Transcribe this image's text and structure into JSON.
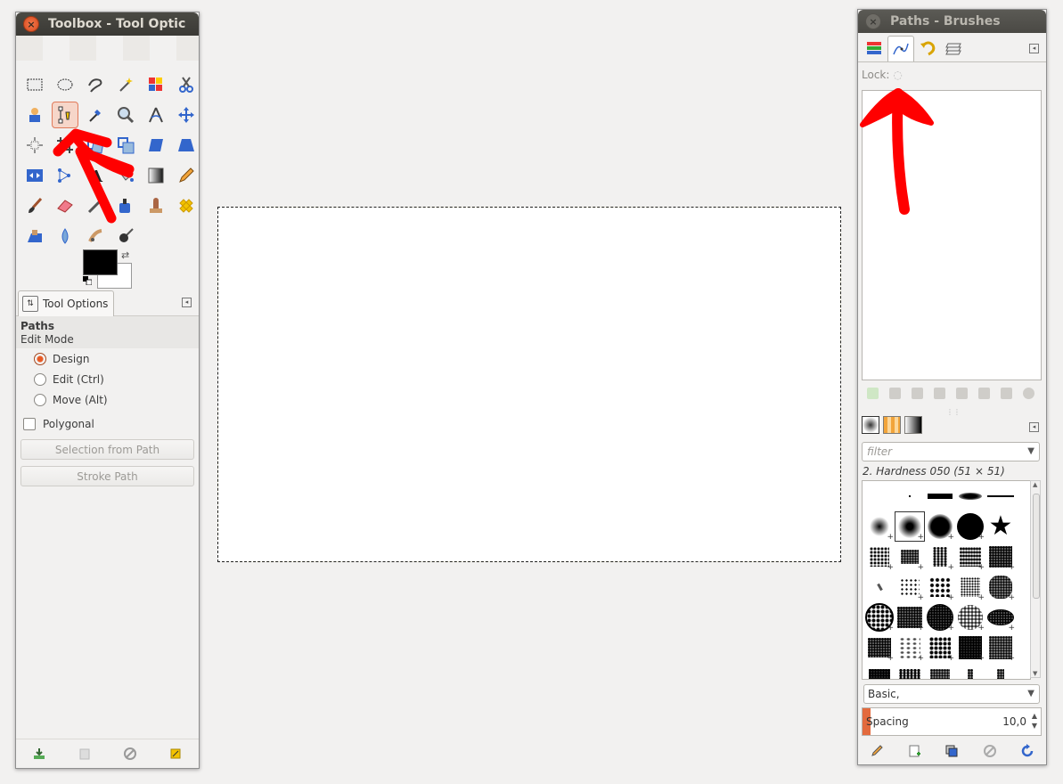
{
  "toolbox": {
    "title": "Toolbox - Tool Optic",
    "close_glyph": "×",
    "tools": [
      "rect-select-icon",
      "ellipse-select-icon",
      "free-select-icon",
      "fuzzy-select-icon",
      "select-by-color-icon",
      "scissors-select-icon",
      "foreground-select-icon",
      "paths-tool-icon",
      "color-picker-icon",
      "zoom-icon",
      "measure-icon",
      "move-icon",
      "align-icon",
      "crop-icon",
      "rotate-icon",
      "scale-icon",
      "shear-icon",
      "perspective-icon",
      "flip-icon",
      "cage-transform-icon",
      "text-icon",
      "bucket-fill-icon",
      "blend-icon",
      "pencil-icon",
      "paintbrush-icon",
      "eraser-icon",
      "airbrush-icon",
      "ink-icon",
      "clone-icon",
      "heal-icon",
      "perspective-clone-icon",
      "blur-icon",
      "smudge-icon",
      "dodge-burn-icon"
    ],
    "active_tool": "paths-tool-icon",
    "colors": {
      "foreground": "#000000",
      "background": "#ffffff"
    }
  },
  "tool_options": {
    "tab_label": "Tool Options",
    "section_title": "Paths",
    "edit_mode_label": "Edit Mode",
    "modes": [
      {
        "label": "Design",
        "checked": true
      },
      {
        "label": "Edit (Ctrl)",
        "checked": false
      },
      {
        "label": "Move (Alt)",
        "checked": false
      }
    ],
    "polygonal_label": "Polygonal",
    "polygonal_checked": false,
    "selection_from_path_label": "Selection from Path",
    "stroke_path_label": "Stroke Path"
  },
  "dock": {
    "title": "Paths - Brushes",
    "close_glyph": "×",
    "tabs": [
      "layers-tab-icon",
      "paths-tab-icon",
      "undo-history-tab-icon",
      "channels-tab-icon"
    ],
    "lock_label": "Lock:",
    "brushes": {
      "filter_placeholder": "filter",
      "selected_brush_name": "2. Hardness 050 (51 × 51)",
      "preset_value": "Basic,",
      "spacing_label": "Spacing",
      "spacing_value": "10,0"
    }
  },
  "colors": {
    "accent": "#e85a24",
    "annotation_red": "#ff0000",
    "titlebar": "#3c3b37"
  }
}
